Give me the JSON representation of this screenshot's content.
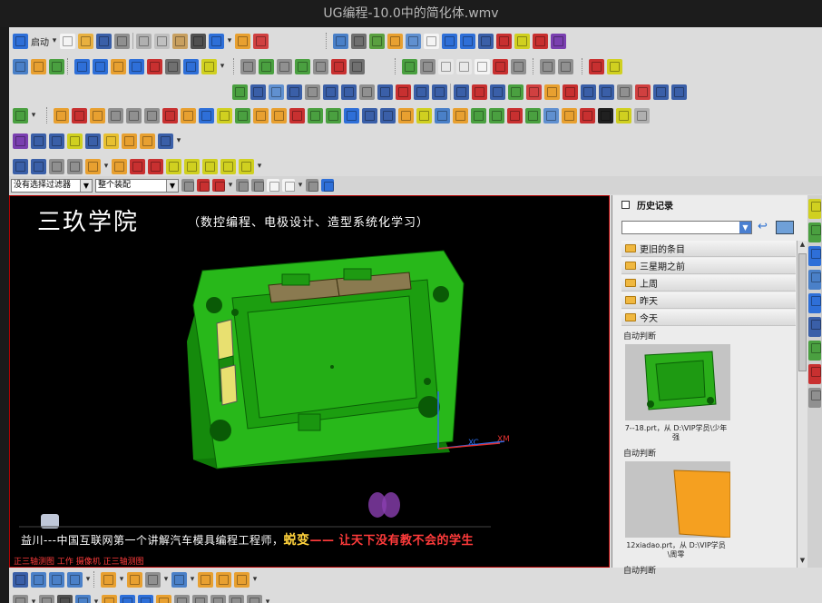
{
  "video_title": "UG编程-10.0中的简化体.wmv",
  "toolbar": {
    "start_label": "启动",
    "colors": [
      "#2e6fd8",
      "#e8a030",
      "#4aa040",
      "#c83030",
      "#7a3fb0",
      "#d0d020",
      "#3aa0c8",
      "#606060"
    ]
  },
  "selection_bar": {
    "filter_value": "没有选择过滤器",
    "scope_value": "整个装配"
  },
  "viewport": {
    "logo": "三玖学院",
    "subtitle": "（数控编程、电极设计、造型系统化学习）",
    "tagline_prefix": "益川---中国互联网第一个讲解汽车模具编程工程师，",
    "tagline_name": "蜕变",
    "tagline_suffix": "—— 让天下没有教不会的学生",
    "hint": "正三轴测图 工作 摄像机 正三轴测图",
    "axis_xc": "XC",
    "axis_xm": "XM",
    "model_color": "#22b014"
  },
  "history_panel": {
    "title": "历史记录",
    "groups": [
      "更旧的条目",
      "三星期之前",
      "上周",
      "昨天",
      "今天"
    ],
    "section_label": "自动判断",
    "entries": [
      {
        "caption": "7--18.prt，从 D:\\VIP学员\\少年强"
      },
      {
        "caption": "12xiadao.prt，从 D:\\VIP学员\\周零"
      }
    ],
    "trailing_section": "自动判断"
  }
}
